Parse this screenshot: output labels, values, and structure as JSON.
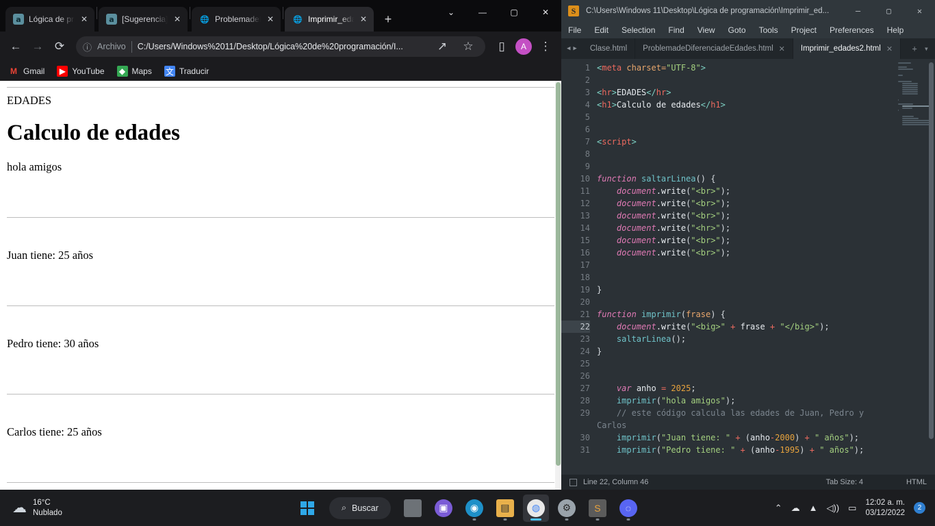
{
  "browser": {
    "tabs": [
      {
        "title": "Lógica de pro",
        "favicon": "a-favicon",
        "active": false
      },
      {
        "title": "[Sugerencia]",
        "favicon": "a-favicon",
        "active": false
      },
      {
        "title": "ProblemadeD",
        "favicon": "globe-favicon",
        "active": false
      },
      {
        "title": "Imprimir_eda",
        "favicon": "globe-favicon",
        "active": true
      }
    ],
    "new_tab_label": "+",
    "window_controls": {
      "list": "⌄",
      "minimize": "—",
      "maximize": "▢",
      "close": "✕"
    },
    "toolbar": {
      "back": "←",
      "forward": "→",
      "reload": "⟳",
      "info": "ⓘ",
      "scheme_label": "Archivo",
      "url": "C:/Users/Windows%2011/Desktop/Lógica%20de%20programación/I...",
      "share": "↗",
      "star": "☆",
      "sidepanel": "▯",
      "avatar": "A",
      "menu": "⋮"
    },
    "bookmarks": [
      {
        "label": "Gmail",
        "icon": "gmail-icon"
      },
      {
        "label": "YouTube",
        "icon": "youtube-icon"
      },
      {
        "label": "Maps",
        "icon": "maps-icon"
      },
      {
        "label": "Traducir",
        "icon": "translate-icon"
      }
    ],
    "page": {
      "label_edades": "EDADES",
      "heading": "Calculo de edades",
      "line_hola": "hola amigos",
      "line_juan": "Juan tiene: 25 años",
      "line_pedro": "Pedro tiene: 30 años",
      "line_carlos": "Carlos tiene: 25 años"
    }
  },
  "sublime": {
    "title": "C:\\Users\\Windows 11\\Desktop\\Lógica de programación\\Imprimir_ed...",
    "logo": "S",
    "window_controls": {
      "minimize": "—",
      "maximize": "▢",
      "close": "✕"
    },
    "menu": [
      "File",
      "Edit",
      "Selection",
      "Find",
      "View",
      "Goto",
      "Tools",
      "Project",
      "Preferences",
      "Help"
    ],
    "tabs": [
      {
        "label": "Clase.html",
        "active": false,
        "close": ""
      },
      {
        "label": "ProblemadeDiferenciadeEdades.html",
        "active": false,
        "close": "✕"
      },
      {
        "label": "Imprimir_edades2.html",
        "active": true,
        "close": "✕"
      }
    ],
    "tab_add": "+",
    "tab_menu": "▾",
    "nav_prev": "◀",
    "nav_next": "▶",
    "highlighted_line": 22,
    "status": {
      "line_column": "Line 22, Column 46",
      "tab_size": "Tab Size: 4",
      "syntax": "HTML"
    },
    "code_lines": [
      {
        "n": 1,
        "tokens": [
          {
            "t": "&lt;",
            "c": "t-tagbr"
          },
          {
            "t": "meta",
            "c": "t-tag"
          },
          {
            "t": " charset=",
            "c": "t-attr"
          },
          {
            "t": "\"UTF-8\"",
            "c": "t-str"
          },
          {
            "t": "&gt;",
            "c": "t-tagbr"
          }
        ]
      },
      {
        "n": 2,
        "tokens": []
      },
      {
        "n": 3,
        "tokens": [
          {
            "t": "&lt;",
            "c": "t-tagbr"
          },
          {
            "t": "hr",
            "c": "t-tag"
          },
          {
            "t": "&gt;",
            "c": "t-tagbr"
          },
          {
            "t": "EDADES",
            "c": "t-txt"
          },
          {
            "t": "&lt;/",
            "c": "t-tagbr"
          },
          {
            "t": "hr",
            "c": "t-tag"
          },
          {
            "t": "&gt;",
            "c": "t-tagbr"
          }
        ]
      },
      {
        "n": 4,
        "tokens": [
          {
            "t": "&lt;",
            "c": "t-tagbr"
          },
          {
            "t": "h1",
            "c": "t-tag"
          },
          {
            "t": "&gt;",
            "c": "t-tagbr"
          },
          {
            "t": "Calculo de edades",
            "c": "t-txt"
          },
          {
            "t": "&lt;/",
            "c": "t-tagbr"
          },
          {
            "t": "h1",
            "c": "t-tag"
          },
          {
            "t": "&gt;",
            "c": "t-tagbr"
          }
        ]
      },
      {
        "n": 5,
        "tokens": []
      },
      {
        "n": 6,
        "tokens": []
      },
      {
        "n": 7,
        "tokens": [
          {
            "t": "&lt;",
            "c": "t-tagbr"
          },
          {
            "t": "script",
            "c": "t-tag"
          },
          {
            "t": "&gt;",
            "c": "t-tagbr"
          }
        ]
      },
      {
        "n": 8,
        "tokens": []
      },
      {
        "n": 9,
        "tokens": []
      },
      {
        "n": 10,
        "tokens": [
          {
            "t": "function ",
            "c": "t-kw"
          },
          {
            "t": "saltarLinea",
            "c": "t-name"
          },
          {
            "t": "() {",
            "c": "t-punc"
          }
        ]
      },
      {
        "n": 11,
        "tokens": [
          {
            "t": "    ",
            "c": "t-punc"
          },
          {
            "t": "document",
            "c": "t-fn"
          },
          {
            "t": ".write",
            "c": "t-txt"
          },
          {
            "t": "(",
            "c": "t-punc"
          },
          {
            "t": "\"&lt;br&gt;\"",
            "c": "t-str"
          },
          {
            "t": ");",
            "c": "t-punc"
          }
        ]
      },
      {
        "n": 12,
        "tokens": [
          {
            "t": "    ",
            "c": "t-punc"
          },
          {
            "t": "document",
            "c": "t-fn"
          },
          {
            "t": ".write",
            "c": "t-txt"
          },
          {
            "t": "(",
            "c": "t-punc"
          },
          {
            "t": "\"&lt;br&gt;\"",
            "c": "t-str"
          },
          {
            "t": ");",
            "c": "t-punc"
          }
        ]
      },
      {
        "n": 13,
        "tokens": [
          {
            "t": "    ",
            "c": "t-punc"
          },
          {
            "t": "document",
            "c": "t-fn"
          },
          {
            "t": ".write",
            "c": "t-txt"
          },
          {
            "t": "(",
            "c": "t-punc"
          },
          {
            "t": "\"&lt;br&gt;\"",
            "c": "t-str"
          },
          {
            "t": ");",
            "c": "t-punc"
          }
        ]
      },
      {
        "n": 14,
        "tokens": [
          {
            "t": "    ",
            "c": "t-punc"
          },
          {
            "t": "document",
            "c": "t-fn"
          },
          {
            "t": ".write",
            "c": "t-txt"
          },
          {
            "t": "(",
            "c": "t-punc"
          },
          {
            "t": "\"&lt;hr&gt;\"",
            "c": "t-str"
          },
          {
            "t": ");",
            "c": "t-punc"
          }
        ]
      },
      {
        "n": 15,
        "tokens": [
          {
            "t": "    ",
            "c": "t-punc"
          },
          {
            "t": "document",
            "c": "t-fn"
          },
          {
            "t": ".write",
            "c": "t-txt"
          },
          {
            "t": "(",
            "c": "t-punc"
          },
          {
            "t": "\"&lt;br&gt;\"",
            "c": "t-str"
          },
          {
            "t": ");",
            "c": "t-punc"
          }
        ]
      },
      {
        "n": 16,
        "tokens": [
          {
            "t": "    ",
            "c": "t-punc"
          },
          {
            "t": "document",
            "c": "t-fn"
          },
          {
            "t": ".write",
            "c": "t-txt"
          },
          {
            "t": "(",
            "c": "t-punc"
          },
          {
            "t": "\"&lt;br&gt;\"",
            "c": "t-str"
          },
          {
            "t": ");",
            "c": "t-punc"
          }
        ]
      },
      {
        "n": 17,
        "tokens": []
      },
      {
        "n": 18,
        "tokens": []
      },
      {
        "n": 19,
        "tokens": [
          {
            "t": "}",
            "c": "t-punc"
          }
        ]
      },
      {
        "n": 20,
        "tokens": []
      },
      {
        "n": 21,
        "tokens": [
          {
            "t": "function ",
            "c": "t-kw"
          },
          {
            "t": "imprimir",
            "c": "t-name"
          },
          {
            "t": "(",
            "c": "t-punc"
          },
          {
            "t": "frase",
            "c": "t-var"
          },
          {
            "t": ") {",
            "c": "t-punc"
          }
        ]
      },
      {
        "n": 22,
        "tokens": [
          {
            "t": "    ",
            "c": "t-punc"
          },
          {
            "t": "document",
            "c": "t-fn"
          },
          {
            "t": ".write",
            "c": "t-txt"
          },
          {
            "t": "(",
            "c": "t-punc"
          },
          {
            "t": "\"&lt;big&gt;\"",
            "c": "t-str"
          },
          {
            "t": " + ",
            "c": "t-op"
          },
          {
            "t": "frase",
            "c": "t-txt"
          },
          {
            "t": " + ",
            "c": "t-op"
          },
          {
            "t": "\"&lt;/big&gt;\"",
            "c": "t-str"
          },
          {
            "t": ");",
            "c": "t-punc"
          }
        ]
      },
      {
        "n": 23,
        "tokens": [
          {
            "t": "    ",
            "c": "t-punc"
          },
          {
            "t": "saltarLinea",
            "c": "t-name"
          },
          {
            "t": "();",
            "c": "t-punc"
          }
        ]
      },
      {
        "n": 24,
        "tokens": [
          {
            "t": "}",
            "c": "t-punc"
          }
        ]
      },
      {
        "n": 25,
        "tokens": []
      },
      {
        "n": 26,
        "tokens": []
      },
      {
        "n": 27,
        "tokens": [
          {
            "t": "    ",
            "c": "t-punc"
          },
          {
            "t": "var ",
            "c": "t-kw"
          },
          {
            "t": "anho",
            "c": "t-txt"
          },
          {
            "t": " = ",
            "c": "t-op"
          },
          {
            "t": "2025",
            "c": "t-num"
          },
          {
            "t": ";",
            "c": "t-punc"
          }
        ]
      },
      {
        "n": 28,
        "tokens": [
          {
            "t": "    ",
            "c": "t-punc"
          },
          {
            "t": "imprimir",
            "c": "t-name"
          },
          {
            "t": "(",
            "c": "t-punc"
          },
          {
            "t": "\"hola amigos\"",
            "c": "t-str"
          },
          {
            "t": ");",
            "c": "t-punc"
          }
        ]
      },
      {
        "n": 29,
        "tokens": [
          {
            "t": "    ",
            "c": "t-punc"
          },
          {
            "t": "// este código calcula las edades de Juan, Pedro y Carlos",
            "c": "t-com"
          }
        ]
      },
      {
        "n": 30,
        "tokens": [
          {
            "t": "    ",
            "c": "t-punc"
          },
          {
            "t": "imprimir",
            "c": "t-name"
          },
          {
            "t": "(",
            "c": "t-punc"
          },
          {
            "t": "\"Juan tiene: \"",
            "c": "t-str"
          },
          {
            "t": " + ",
            "c": "t-op"
          },
          {
            "t": "(",
            "c": "t-punc"
          },
          {
            "t": "anho",
            "c": "t-txt"
          },
          {
            "t": "-",
            "c": "t-op"
          },
          {
            "t": "2000",
            "c": "t-num"
          },
          {
            "t": ")",
            "c": "t-punc"
          },
          {
            "t": " + ",
            "c": "t-op"
          },
          {
            "t": "\" años\"",
            "c": "t-str"
          },
          {
            "t": ");",
            "c": "t-punc"
          }
        ]
      },
      {
        "n": 31,
        "tokens": [
          {
            "t": "    ",
            "c": "t-punc"
          },
          {
            "t": "imprimir",
            "c": "t-name"
          },
          {
            "t": "(",
            "c": "t-punc"
          },
          {
            "t": "\"Pedro tiene: \"",
            "c": "t-str"
          },
          {
            "t": " + ",
            "c": "t-op"
          },
          {
            "t": "(",
            "c": "t-punc"
          },
          {
            "t": "anho",
            "c": "t-txt"
          },
          {
            "t": "-",
            "c": "t-op"
          },
          {
            "t": "1995",
            "c": "t-num"
          },
          {
            "t": ")",
            "c": "t-punc"
          },
          {
            "t": " + ",
            "c": "t-op"
          },
          {
            "t": "\" años\"",
            "c": "t-str"
          },
          {
            "t": ");",
            "c": "t-punc"
          }
        ]
      }
    ]
  },
  "taskbar": {
    "weather": {
      "temperature": "16°C",
      "condition": "Nublado",
      "icon": "cloud-icon"
    },
    "start_label": "start-icon",
    "search_label": "Buscar",
    "search_icon": "search-icon",
    "apps": [
      {
        "name": "task-view",
        "glyph": "▫",
        "state": "idle"
      },
      {
        "name": "teams",
        "glyph": "▣",
        "state": "idle"
      },
      {
        "name": "edge",
        "glyph": "◉",
        "state": "running"
      },
      {
        "name": "file-explorer",
        "glyph": "▤",
        "state": "running"
      },
      {
        "name": "chrome",
        "glyph": "◍",
        "state": "active"
      },
      {
        "name": "settings",
        "glyph": "⚙",
        "state": "running"
      },
      {
        "name": "sublime-text",
        "glyph": "S",
        "state": "running"
      },
      {
        "name": "discord",
        "glyph": "◌",
        "state": "running"
      }
    ],
    "tray": {
      "chevron": "⌃",
      "onedrive": "☁",
      "wifi": "⌁",
      "volume": "🔊",
      "battery": "▭",
      "time": "12:02 a. m.",
      "date": "03/12/2022",
      "notification_count": "2"
    }
  }
}
